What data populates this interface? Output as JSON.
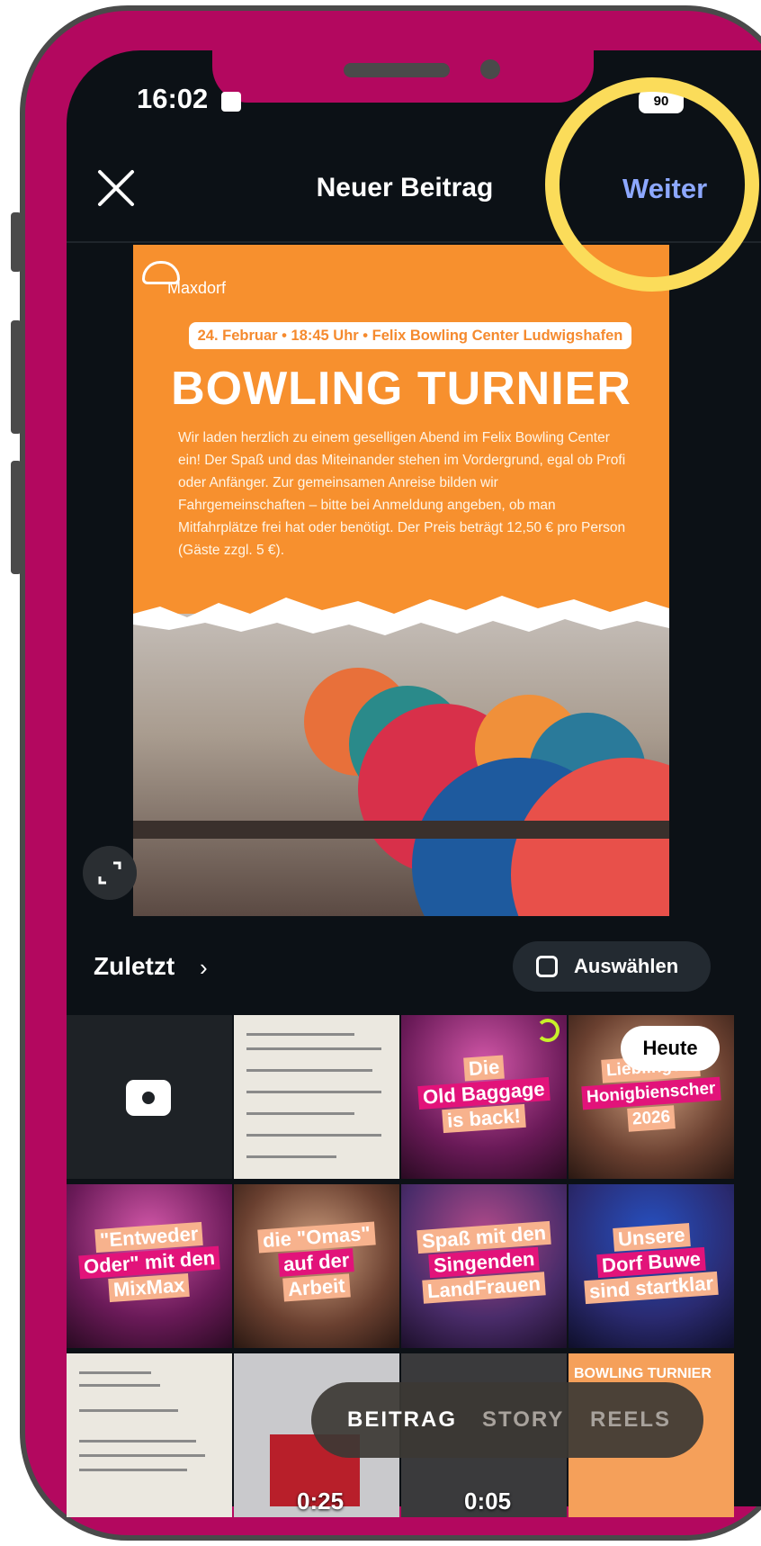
{
  "status_bar": {
    "time": "16:02",
    "battery": "90"
  },
  "header": {
    "title": "Neuer Beitrag",
    "next_label": "Weiter"
  },
  "preview_post": {
    "brand": "Maxdorf",
    "date_line": "24. Februar • 18:45 Uhr • Felix Bowling Center Ludwigshafen",
    "title": "BOWLING TURNIER",
    "body": "Wir laden herzlich zu einem geselligen Abend im Felix Bowling Center ein! Der Spaß und das Miteinander stehen im Vordergrund, egal ob Profi oder Anfänger. Zur gemeinsamen Anreise bilden wir Fahrgemeinschaften – bitte bei Anmeldung angeben, ob man Mitfahrplätze frei hat oder benötigt. Der Preis beträgt 12,50 € pro Person (Gäste zzgl. 5 €)."
  },
  "gallery": {
    "album_label": "Zuletzt",
    "select_label": "Auswählen",
    "today_badge": "Heute",
    "tiles": [
      {
        "lines": [
          "Die",
          "Old Baggage",
          "is back!"
        ]
      },
      {
        "lines": [
          "Lieblings...",
          "Honigbienscher",
          "2026"
        ]
      },
      {
        "lines": [
          "\"Entweder",
          "Oder\" mit den",
          "MixMax"
        ]
      },
      {
        "lines": [
          "die \"Omas\"",
          "auf der",
          "Arbeit"
        ]
      },
      {
        "lines": [
          "Spaß mit den",
          "Singenden",
          "LandFrauen"
        ]
      },
      {
        "lines": [
          "Unsere",
          "Dorf Buwe",
          "sind startklar"
        ]
      }
    ],
    "durations": [
      "0:25",
      "0:05"
    ],
    "last_tile_text": "BOWLING TURNIER"
  },
  "mode_switch": {
    "modes": [
      "BEITRAG",
      "STORY",
      "REELS"
    ],
    "active": "BEITRAG"
  },
  "colors": {
    "accent": "#8da8ff",
    "frame": "#b3085f",
    "highlight": "#fbdc5a",
    "poster": "#f7902e"
  }
}
